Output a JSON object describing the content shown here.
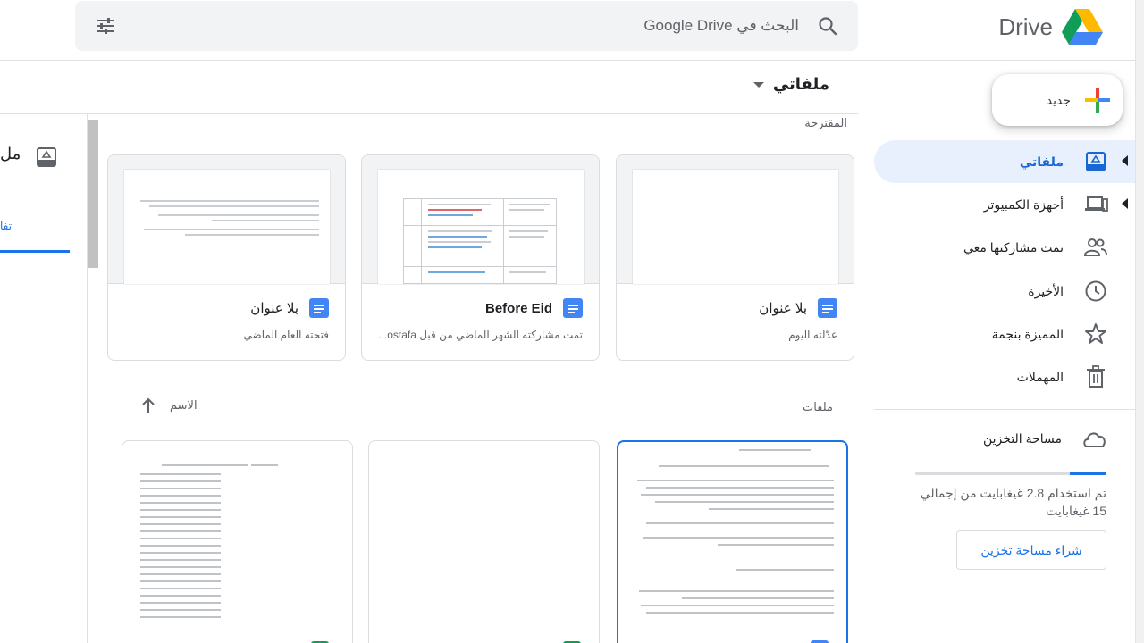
{
  "header": {
    "logo_text": "Drive",
    "search_placeholder": "البحث في Google Drive"
  },
  "sidebar": {
    "new_label": "جديد",
    "items": [
      {
        "label": "ملفاتي",
        "icon": "my-drive-icon",
        "active": true
      },
      {
        "label": "أجهزة الكمبيوتر",
        "icon": "computers-icon"
      },
      {
        "label": "تمت مشاركتها معي",
        "icon": "shared-icon"
      },
      {
        "label": "الأخيرة",
        "icon": "recent-icon"
      },
      {
        "label": "المميزة بنجمة",
        "icon": "star-icon"
      },
      {
        "label": "المهملات",
        "icon": "trash-icon"
      }
    ],
    "storage_label": "مساحة التخزين",
    "storage_used_fraction": 0.19,
    "storage_text": "تم استخدام 2.8 غيغابايت من إجمالي 15 غيغابايت",
    "buy_storage": "شراء مساحة تخزين"
  },
  "main": {
    "title": "ملفاتي",
    "suggested_label": "المقترحة",
    "files_label": "ملفات",
    "sort_label": "الاسم",
    "details_title": "مل",
    "details_tab": "تفا",
    "suggested": [
      {
        "title": "بلا عنوان",
        "subtitle": "عدّلته اليوم"
      },
      {
        "title": "Before Eid",
        "subtitle": "تمت مشاركته الشهر الماضي من قبل ostafa..."
      },
      {
        "title": "بلا عنوان",
        "subtitle": "فتحته العام الماضي"
      }
    ]
  },
  "colors": {
    "accent": "#1a73e8",
    "active_bg": "#e8f0fe"
  }
}
